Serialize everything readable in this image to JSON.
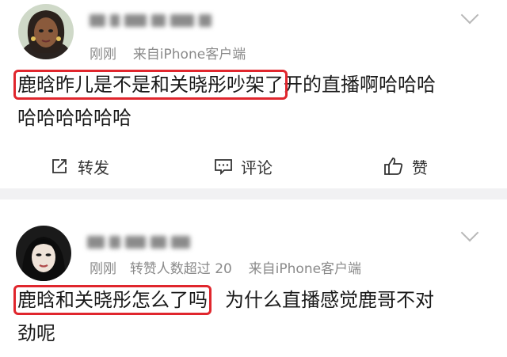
{
  "posts": [
    {
      "time": "刚刚",
      "source": "来自iPhone客户端",
      "extra": "",
      "content_highlight": "鹿晗昨儿是不是和关晓彤吵架了",
      "content_rest_line1": "开的直播啊哈哈哈",
      "content_line2": "哈哈哈哈哈哈",
      "actions": {
        "repost": "转发",
        "comment": "评论",
        "like": "赞"
      }
    },
    {
      "time": "刚刚",
      "extra": "转赞人数超过 20",
      "source": "来自iPhone客户端",
      "content_highlight": "鹿晗和关晓彤怎么了吗",
      "content_rest_line1": "为什么直播感觉鹿哥不对",
      "content_line2": "劲呢"
    }
  ],
  "colors": {
    "highlight": "#e0262d",
    "meta": "#8a8a8a",
    "separator": "#f1f1f3"
  },
  "icons": [
    "avatar-cartoon",
    "avatar-photo",
    "chevron-down-icon",
    "repost-icon",
    "comment-icon",
    "like-icon"
  ]
}
